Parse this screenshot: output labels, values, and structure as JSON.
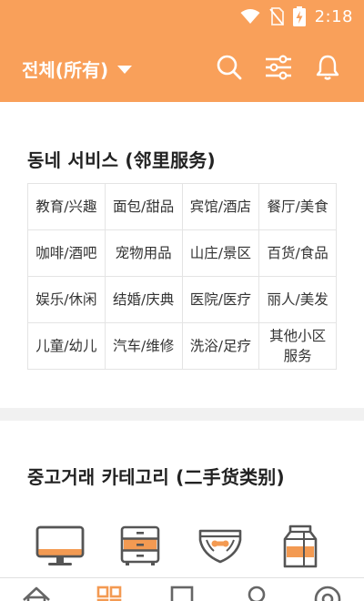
{
  "status_bar": {
    "time": "2:18"
  },
  "header": {
    "filter_label": "전체(所有)"
  },
  "services": {
    "title": "동네 서비스 (邻里服务)",
    "rows": [
      [
        "教育/兴趣",
        "面包/甜品",
        "宾馆/酒店",
        "餐厅/美食"
      ],
      [
        "咖啡/酒吧",
        "宠物用品",
        "山庄/景区",
        "百货/食品"
      ],
      [
        "娱乐/休闲",
        "结婚/庆典",
        "医院/医疗",
        "丽人/美发"
      ],
      [
        "儿童/幼儿",
        "汽车/维修",
        "洗浴/足疗",
        "其他小区\n服务"
      ]
    ]
  },
  "categories": {
    "title": "중고거래 카테고리 (二手货类别)",
    "items": [
      "monitor-icon",
      "drawer-cabinet-icon",
      "diaper-icon",
      "milk-carton-icon"
    ]
  },
  "bottom_nav": {
    "items": [
      "home-icon",
      "grid-icon",
      "chat-icon",
      "person-icon",
      "settings-icon"
    ]
  },
  "colors": {
    "accent": "#f9a05a",
    "icon_dark": "#555555",
    "divider": "#f1f1f1"
  }
}
